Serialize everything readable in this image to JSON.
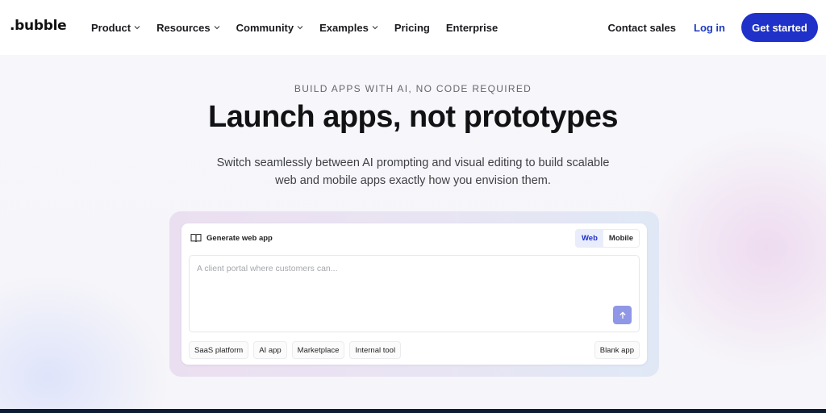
{
  "nav": {
    "logo": ".bubble",
    "items": [
      {
        "label": "Product",
        "dropdown": true
      },
      {
        "label": "Resources",
        "dropdown": true
      },
      {
        "label": "Community",
        "dropdown": true
      },
      {
        "label": "Examples",
        "dropdown": true
      },
      {
        "label": "Pricing",
        "dropdown": false
      },
      {
        "label": "Enterprise",
        "dropdown": false
      }
    ],
    "contact_sales": "Contact sales",
    "log_in": "Log in",
    "get_started": "Get started"
  },
  "hero": {
    "eyebrow": "BUILD APPS WITH AI, NO CODE REQUIRED",
    "headline": "Launch apps, not prototypes",
    "subtext": "Switch seamlessly between AI prompting and visual editing to build scalable web and mobile apps exactly how you envision them."
  },
  "prompt_card": {
    "title": "Generate web app",
    "toggle": {
      "options": [
        "Web",
        "Mobile"
      ],
      "selected": "Web"
    },
    "placeholder": "A client portal where customers can...",
    "chips": [
      "SaaS platform",
      "AI app",
      "Marketplace",
      "Internal tool"
    ],
    "blank_app": "Blank app"
  },
  "colors": {
    "brand": "#1f31c8",
    "send_button": "#8f97e6",
    "footer_bar": "#0d1b33"
  },
  "icons": {
    "header": "book-open-icon",
    "send": "arrow-up-icon",
    "dropdown": "chevron-down-icon"
  }
}
